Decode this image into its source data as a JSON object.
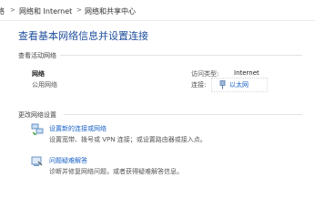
{
  "breadcrumb": {
    "items": [
      "络",
      "网络和 Internet",
      "网络和共享中心"
    ],
    "separator": ">"
  },
  "page_title": "查看基本网络信息并设置连接",
  "active_networks": {
    "section_label": "查看活动网络",
    "network_name": "网络",
    "network_type": "公用网络",
    "access_type_label": "访问类型:",
    "access_type_value": "Internet",
    "connections_label": "连接:",
    "connection_link": "以太网"
  },
  "change_settings": {
    "section_label": "更改网络设置",
    "items": [
      {
        "title": "设置新的连接或网络",
        "description": "设置宽带、拨号或 VPN 连接；或设置路由器或接入点。",
        "icon": "network-setup-icon"
      },
      {
        "title": "问题疑难解答",
        "description": "诊断并修复网络问题，或者获得疑难解答信息。",
        "icon": "troubleshoot-icon"
      }
    ]
  },
  "colors": {
    "link": "#1a62c7",
    "title": "#1f4e9c"
  }
}
